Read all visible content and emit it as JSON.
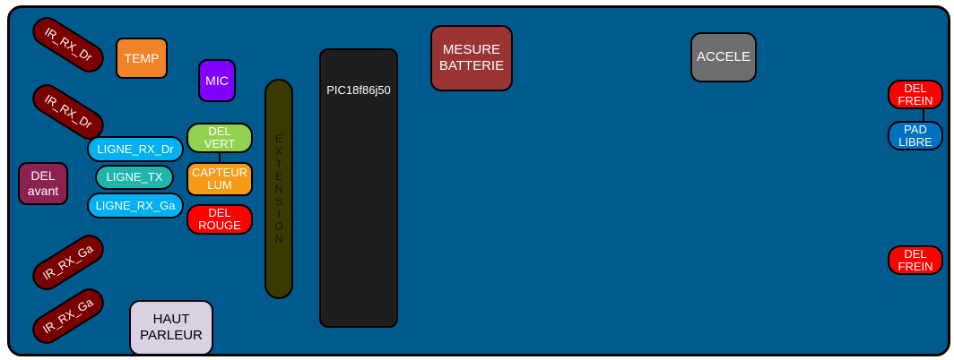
{
  "components": {
    "ir1": "IR_RX_Dr",
    "ir2": "IR_RX_Dr",
    "ir3": "IR_RX_Ga",
    "ir4": "IR_RX_Ga",
    "temp": "TEMP",
    "mic": "MIC",
    "del_avant": "DEL\navant",
    "ligne_rx_dr": "LIGNE_RX_Dr",
    "ligne_tx": "LIGNE_TX",
    "ligne_rx_ga": "LIGNE_RX_Ga",
    "del_vert": "DEL\nVERT",
    "capteur_lum": "CAPTEUR\nLUM",
    "del_rouge": "DEL\nROUGE",
    "extension": "EXTENSION",
    "mcu": "PIC18f86j50",
    "mesure_batterie": "MESURE\nBATTERIE",
    "accele": "ACCELE",
    "del_frein_top": "DEL\nFREIN",
    "pad_libre": "PAD\nLIBRE",
    "del_frein_bottom": "DEL\nFREIN",
    "haut_parleur": "HAUT\nPARLEUR"
  },
  "colors": {
    "board": "#005a8e",
    "ir": "#7a0000",
    "temp": "#f0832a",
    "mic": "#7f00ff",
    "del_avant": "#8b2252",
    "ligne": "#00b0f0",
    "ligne_tx": "#1fb5ad",
    "del_vert": "#92d050",
    "capteur": "#f49b1a",
    "del_rouge": "#ff0000",
    "extension": "#3a3a00",
    "mcu": "#1e1e1e",
    "batterie": "#9b3535",
    "accele": "#6e6e6e",
    "pad_libre": "#0070c0",
    "haut_parleur": "#d9d0e3"
  }
}
